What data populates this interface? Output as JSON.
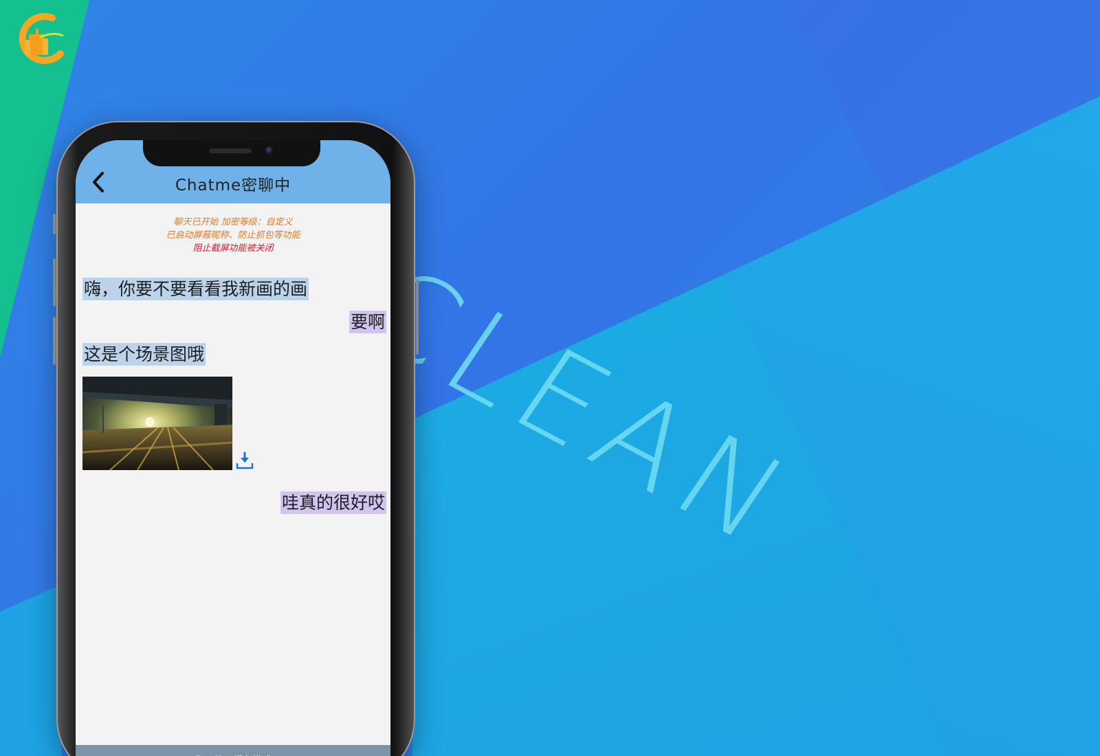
{
  "background": {
    "watermark": "CLEAN",
    "colors": {
      "base": "#2f86e6",
      "green": "#15c08f",
      "cyan": "#1bb0e2",
      "watermark": "#6fdcf2"
    }
  },
  "logo": {
    "icon": "logo-badge-icon"
  },
  "chat": {
    "header": {
      "title": "Chatme密聊中",
      "back_icon": "chevron-left-icon",
      "color": "#6fb2e9"
    },
    "system_notice": {
      "line1": "聊天已开始   加密等级：自定义",
      "line2": "已启动屏蔽昵称、防止抓包等功能",
      "line3": "阻止截屏功能被关闭"
    },
    "messages": [
      {
        "side": "left",
        "text": "嗨，你要不要看看我新画的画"
      },
      {
        "side": "right",
        "text": "要啊"
      },
      {
        "side": "left",
        "text": "这是个场景图哦"
      },
      {
        "side": "left",
        "type": "image",
        "icon": "landscape-image-icon",
        "action_icon": "download-icon"
      },
      {
        "side": "right",
        "text": "哇真的很好哎"
      }
    ],
    "status_bar": {
      "text": "您正处于缓存模式"
    }
  }
}
